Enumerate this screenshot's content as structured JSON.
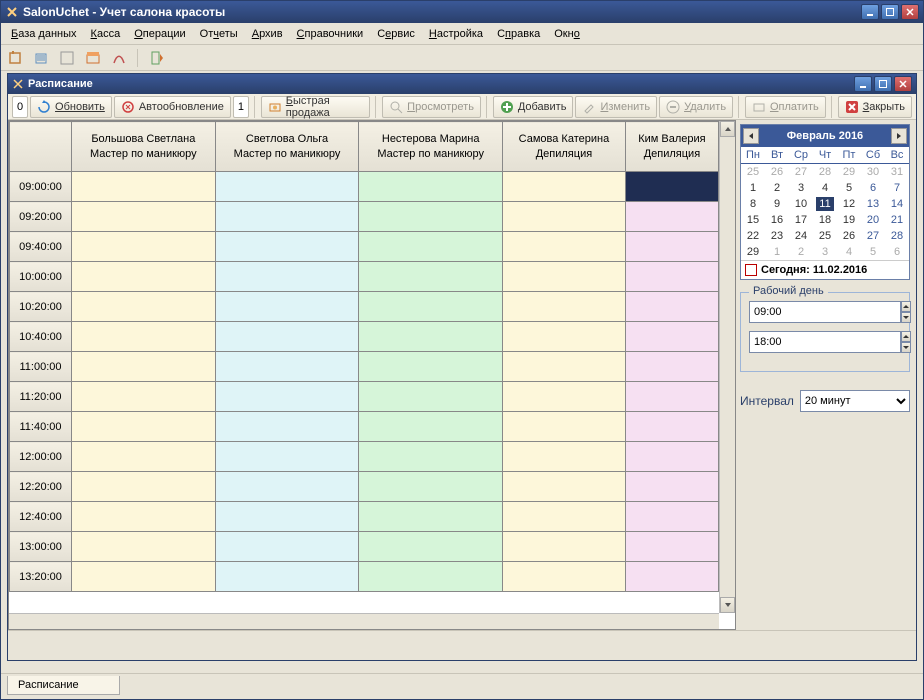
{
  "app": {
    "title": "SalonUchet - Учет салона красоты"
  },
  "menu": [
    {
      "pre": "",
      "u": "Б",
      "post": "аза данных"
    },
    {
      "pre": "",
      "u": "К",
      "post": "асса"
    },
    {
      "pre": "",
      "u": "О",
      "post": "перации"
    },
    {
      "pre": "От",
      "u": "ч",
      "post": "еты"
    },
    {
      "pre": "",
      "u": "А",
      "post": "рхив"
    },
    {
      "pre": "",
      "u": "С",
      "post": "правочники"
    },
    {
      "pre": "С",
      "u": "е",
      "post": "рвис"
    },
    {
      "pre": "",
      "u": "Н",
      "post": "астройка"
    },
    {
      "pre": "С",
      "u": "п",
      "post": "равка"
    },
    {
      "pre": "Окн",
      "u": "о",
      "post": ""
    }
  ],
  "child": {
    "title": "Расписание"
  },
  "toolbar": {
    "zero": "0",
    "refresh": "Обновить",
    "autorefresh": "Автообновление",
    "autorefresh_val": "1",
    "quicksale": "Быстрая продажа",
    "view": "Просмотреть",
    "add": "Добавить",
    "edit": "Изменить",
    "delete": "Удалить",
    "pay": "Оплатить",
    "close": "Закрыть"
  },
  "staff": [
    {
      "name": "Большова Светлана",
      "role": "Мастер по маникюру",
      "cls": "c1"
    },
    {
      "name": "Светлова Ольга",
      "role": "Мастер по маникюру",
      "cls": "c2"
    },
    {
      "name": "Нестерова Марина",
      "role": "Мастер по маникюру",
      "cls": "c3"
    },
    {
      "name": "Самова Катерина",
      "role": "Депиляция",
      "cls": "c4"
    },
    {
      "name": "Ким Валерия",
      "role": "Депиляция",
      "cls": "c5"
    }
  ],
  "times": [
    "09:00:00",
    "09:20:00",
    "09:40:00",
    "10:00:00",
    "10:20:00",
    "10:40:00",
    "11:00:00",
    "11:20:00",
    "11:40:00",
    "12:00:00",
    "12:20:00",
    "12:40:00",
    "13:00:00",
    "13:20:00"
  ],
  "calendar": {
    "title": "Февраль 2016",
    "dow": [
      "Пн",
      "Вт",
      "Ср",
      "Чт",
      "Пт",
      "Сб",
      "Вс"
    ],
    "weeks": [
      [
        {
          "d": "25",
          "out": true
        },
        {
          "d": "26",
          "out": true
        },
        {
          "d": "27",
          "out": true
        },
        {
          "d": "28",
          "out": true
        },
        {
          "d": "29",
          "out": true
        },
        {
          "d": "30",
          "out": true
        },
        {
          "d": "31",
          "out": true
        }
      ],
      [
        {
          "d": "1"
        },
        {
          "d": "2"
        },
        {
          "d": "3"
        },
        {
          "d": "4"
        },
        {
          "d": "5"
        },
        {
          "d": "6"
        },
        {
          "d": "7"
        }
      ],
      [
        {
          "d": "8"
        },
        {
          "d": "9"
        },
        {
          "d": "10"
        },
        {
          "d": "11",
          "sel": true
        },
        {
          "d": "12"
        },
        {
          "d": "13"
        },
        {
          "d": "14"
        }
      ],
      [
        {
          "d": "15"
        },
        {
          "d": "16"
        },
        {
          "d": "17"
        },
        {
          "d": "18"
        },
        {
          "d": "19"
        },
        {
          "d": "20"
        },
        {
          "d": "21"
        }
      ],
      [
        {
          "d": "22"
        },
        {
          "d": "23"
        },
        {
          "d": "24"
        },
        {
          "d": "25"
        },
        {
          "d": "26"
        },
        {
          "d": "27"
        },
        {
          "d": "28"
        }
      ],
      [
        {
          "d": "29"
        },
        {
          "d": "1",
          "out": true
        },
        {
          "d": "2",
          "out": true
        },
        {
          "d": "3",
          "out": true
        },
        {
          "d": "4",
          "out": true
        },
        {
          "d": "5",
          "out": true
        },
        {
          "d": "6",
          "out": true
        }
      ]
    ],
    "today_label": "Сегодня: 11.02.2016"
  },
  "workday": {
    "legend": "Рабочий день",
    "start": "09:00",
    "end": "18:00"
  },
  "interval": {
    "label": "Интервал",
    "value": "20 минут"
  },
  "tab_label": "Расписание"
}
